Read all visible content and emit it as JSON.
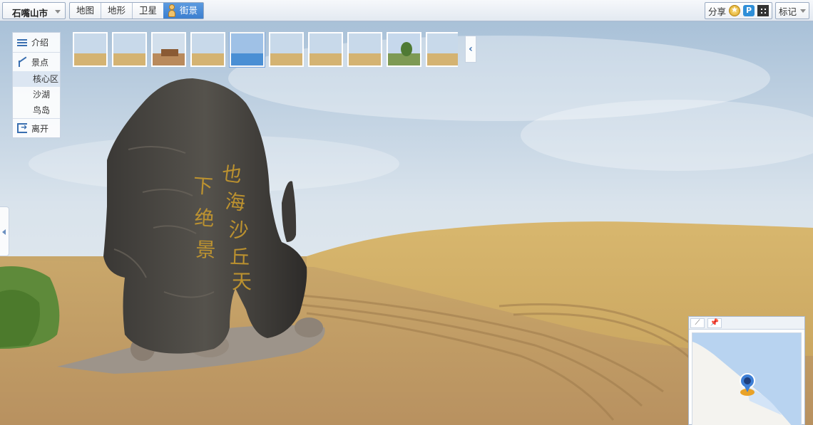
{
  "toolbar": {
    "city": "石嘴山市",
    "map_types": [
      {
        "label": "地图",
        "active": false
      },
      {
        "label": "地形",
        "active": false
      },
      {
        "label": "卫星",
        "active": false
      },
      {
        "label": "街景",
        "active": true
      }
    ],
    "share_label": "分享",
    "mark_label": "标记",
    "icons": [
      "favorite-icon",
      "panorama-p-icon",
      "qr-code-icon"
    ]
  },
  "side_panel": {
    "intro_label": "介绍",
    "spots_label": "景点",
    "spots": [
      {
        "label": "核心区",
        "selected": true
      },
      {
        "label": "沙湖",
        "selected": false
      },
      {
        "label": "鸟岛",
        "selected": false
      }
    ],
    "leave_label": "离开"
  },
  "thumbnails": {
    "count": 10,
    "active_index": 4,
    "scenes": [
      "sand",
      "sand",
      "building",
      "sand",
      "water",
      "sand",
      "sand",
      "sand",
      "trees",
      "sand"
    ]
  },
  "colors": {
    "accent": "#3c7fcf",
    "sky": "#b9d0e6",
    "sand": "#c9a55e",
    "water": "#b8d3f0"
  }
}
